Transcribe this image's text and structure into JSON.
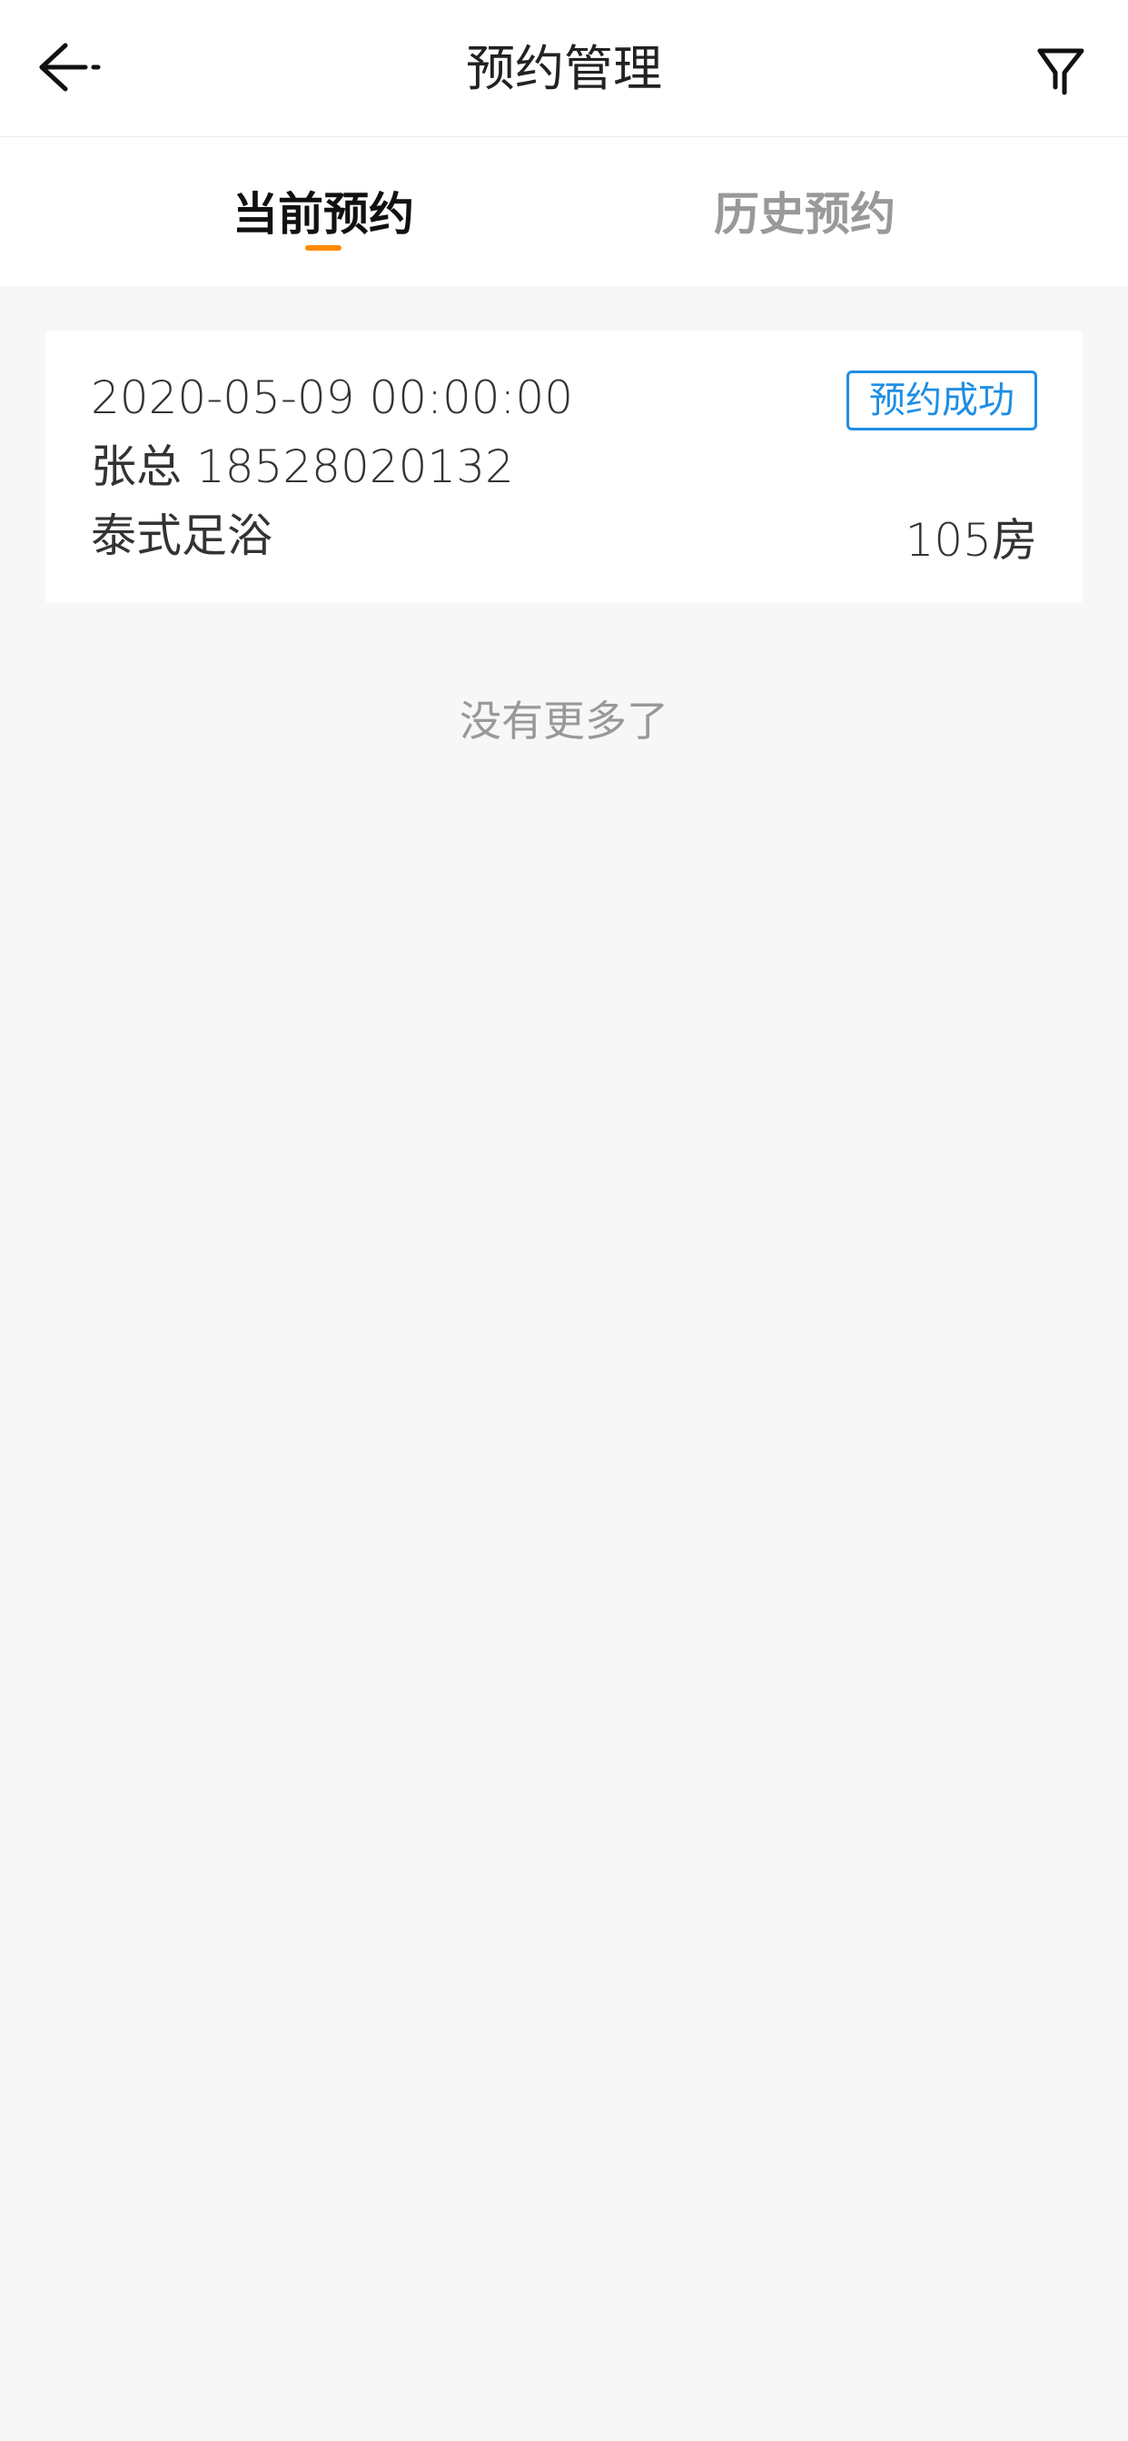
{
  "header": {
    "title": "预约管理",
    "back_icon": "back-arrow-icon",
    "filter_icon": "filter-icon"
  },
  "tabs": [
    {
      "label": "当前预约",
      "active": true
    },
    {
      "label": "历史预约",
      "active": false
    }
  ],
  "colors": {
    "accent": "#ff8a00",
    "status": "#1e8ee5",
    "background": "#f7f7f7"
  },
  "reservations": [
    {
      "datetime": "2020-05-09 00:00:00",
      "contact": "张总 18528020132",
      "service": "泰式足浴",
      "status": "预约成功",
      "room": "105房"
    }
  ],
  "list_end_text": "没有更多了"
}
